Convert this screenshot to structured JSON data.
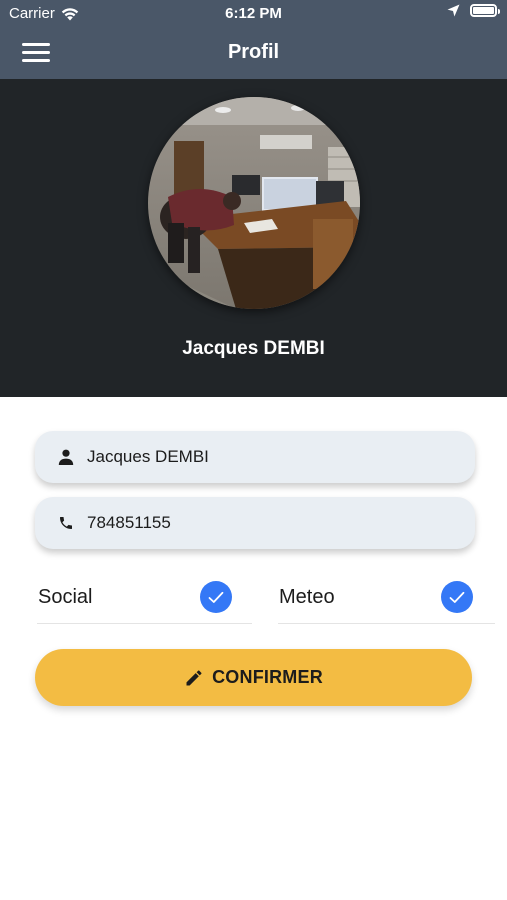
{
  "status_bar": {
    "carrier": "Carrier",
    "time": "6:12 PM"
  },
  "nav": {
    "title": "Profil",
    "menu_icon": "hamburger-menu-icon"
  },
  "profile": {
    "name": "Jacques DEMBI",
    "avatar": "office-photo"
  },
  "form": {
    "name_field": {
      "icon": "person-icon",
      "value": "Jacques DEMBI"
    },
    "phone_field": {
      "icon": "phone-icon",
      "value": "784851155"
    }
  },
  "toggles": [
    {
      "label": "Social",
      "checked": true
    },
    {
      "label": "Meteo",
      "checked": true
    }
  ],
  "confirm_button": {
    "icon": "pencil-icon",
    "label": "CONFIRMER"
  },
  "colors": {
    "nav_bg": "#4a5768",
    "header_bg": "#212528",
    "accent_blue": "#3478f6",
    "button_yellow": "#f3bc43",
    "field_bg": "#e9eef3"
  }
}
